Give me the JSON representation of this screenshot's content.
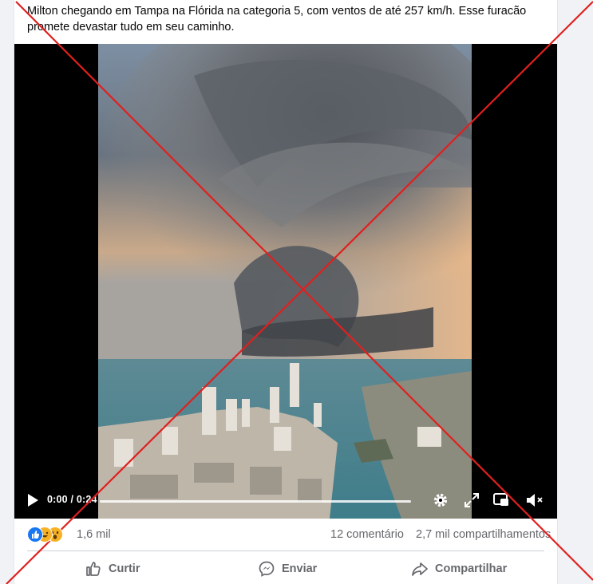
{
  "post": {
    "caption": "Milton chegando em Tampa na Flórida na categoria 5, com ventos de até 257 km/h. Esse furacão promete devastar tudo em seu caminho."
  },
  "video": {
    "time": "0:00 / 0:24",
    "progress": 0.0
  },
  "reactions": {
    "icons": [
      "like-icon",
      "haha-icon",
      "wow-icon"
    ],
    "count": "1,6 mil",
    "comments": "12 comentário",
    "shares": "2,7 mil compartilhamentos"
  },
  "actions": {
    "like_label": "Curtir",
    "send_label": "Enviar",
    "share_label": "Compartilhar"
  },
  "colors": {
    "overlay_x": "#e0201f",
    "accent": "#1877f2",
    "muted_text": "#65676b"
  }
}
